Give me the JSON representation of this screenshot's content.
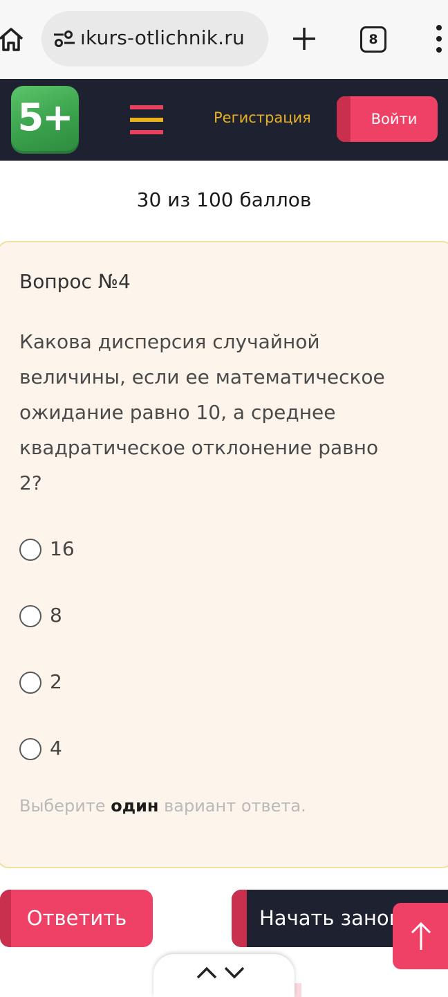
{
  "browser": {
    "url": "ıkurs-otlichnik.ru",
    "tab_count": "8"
  },
  "header": {
    "logo_text": "5+",
    "register_label": "Регистрация",
    "login_label": "Войти",
    "colors": {
      "bg": "#1e2230",
      "accent": "#ef4166",
      "gold": "#e8b21e",
      "logo_green": "#4bb35c"
    }
  },
  "score": {
    "text": "30 из 100 баллов"
  },
  "question": {
    "number_label": "Вопрос №4",
    "lines": [
      "Какова дисперсия случайной",
      "величины, если ее математическое",
      "ожидание равно 10, а среднее",
      "квадратическое отклонение равно",
      "2?"
    ],
    "options": [
      "16",
      "8",
      "2",
      "4"
    ],
    "hint_before": "Выберите",
    "hint_bold": "один",
    "hint_after": "вариант ответа."
  },
  "actions": {
    "answer_label": "Ответить",
    "restart_label": "Начать заново"
  },
  "icons": {
    "home": "home-icon",
    "site_info": "site-info-icon",
    "new_tab": "plus-icon",
    "menu": "more-vert-icon",
    "burger": "hamburger-icon",
    "scroll_top": "arrow-up-icon",
    "prev": "chevron-up-icon",
    "next": "chevron-down-icon"
  }
}
